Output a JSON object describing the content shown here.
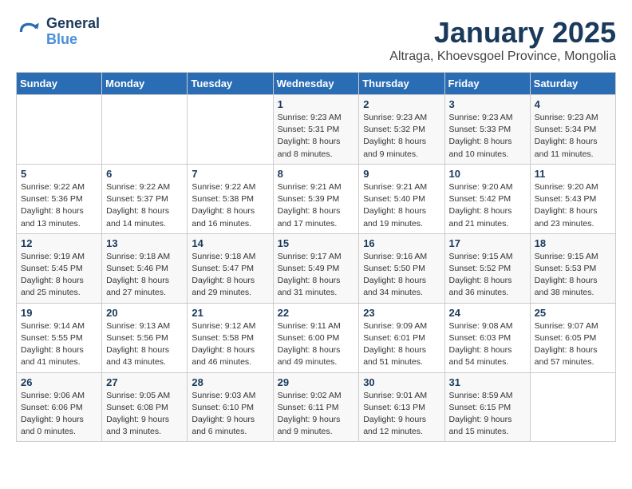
{
  "logo": {
    "line1": "General",
    "line2": "Blue"
  },
  "title": "January 2025",
  "location": "Altraga, Khoevsgoel Province, Mongolia",
  "days_of_week": [
    "Sunday",
    "Monday",
    "Tuesday",
    "Wednesday",
    "Thursday",
    "Friday",
    "Saturday"
  ],
  "weeks": [
    [
      {
        "num": "",
        "info": ""
      },
      {
        "num": "",
        "info": ""
      },
      {
        "num": "",
        "info": ""
      },
      {
        "num": "1",
        "info": "Sunrise: 9:23 AM\nSunset: 5:31 PM\nDaylight: 8 hours\nand 8 minutes."
      },
      {
        "num": "2",
        "info": "Sunrise: 9:23 AM\nSunset: 5:32 PM\nDaylight: 8 hours\nand 9 minutes."
      },
      {
        "num": "3",
        "info": "Sunrise: 9:23 AM\nSunset: 5:33 PM\nDaylight: 8 hours\nand 10 minutes."
      },
      {
        "num": "4",
        "info": "Sunrise: 9:23 AM\nSunset: 5:34 PM\nDaylight: 8 hours\nand 11 minutes."
      }
    ],
    [
      {
        "num": "5",
        "info": "Sunrise: 9:22 AM\nSunset: 5:36 PM\nDaylight: 8 hours\nand 13 minutes."
      },
      {
        "num": "6",
        "info": "Sunrise: 9:22 AM\nSunset: 5:37 PM\nDaylight: 8 hours\nand 14 minutes."
      },
      {
        "num": "7",
        "info": "Sunrise: 9:22 AM\nSunset: 5:38 PM\nDaylight: 8 hours\nand 16 minutes."
      },
      {
        "num": "8",
        "info": "Sunrise: 9:21 AM\nSunset: 5:39 PM\nDaylight: 8 hours\nand 17 minutes."
      },
      {
        "num": "9",
        "info": "Sunrise: 9:21 AM\nSunset: 5:40 PM\nDaylight: 8 hours\nand 19 minutes."
      },
      {
        "num": "10",
        "info": "Sunrise: 9:20 AM\nSunset: 5:42 PM\nDaylight: 8 hours\nand 21 minutes."
      },
      {
        "num": "11",
        "info": "Sunrise: 9:20 AM\nSunset: 5:43 PM\nDaylight: 8 hours\nand 23 minutes."
      }
    ],
    [
      {
        "num": "12",
        "info": "Sunrise: 9:19 AM\nSunset: 5:45 PM\nDaylight: 8 hours\nand 25 minutes."
      },
      {
        "num": "13",
        "info": "Sunrise: 9:18 AM\nSunset: 5:46 PM\nDaylight: 8 hours\nand 27 minutes."
      },
      {
        "num": "14",
        "info": "Sunrise: 9:18 AM\nSunset: 5:47 PM\nDaylight: 8 hours\nand 29 minutes."
      },
      {
        "num": "15",
        "info": "Sunrise: 9:17 AM\nSunset: 5:49 PM\nDaylight: 8 hours\nand 31 minutes."
      },
      {
        "num": "16",
        "info": "Sunrise: 9:16 AM\nSunset: 5:50 PM\nDaylight: 8 hours\nand 34 minutes."
      },
      {
        "num": "17",
        "info": "Sunrise: 9:15 AM\nSunset: 5:52 PM\nDaylight: 8 hours\nand 36 minutes."
      },
      {
        "num": "18",
        "info": "Sunrise: 9:15 AM\nSunset: 5:53 PM\nDaylight: 8 hours\nand 38 minutes."
      }
    ],
    [
      {
        "num": "19",
        "info": "Sunrise: 9:14 AM\nSunset: 5:55 PM\nDaylight: 8 hours\nand 41 minutes."
      },
      {
        "num": "20",
        "info": "Sunrise: 9:13 AM\nSunset: 5:56 PM\nDaylight: 8 hours\nand 43 minutes."
      },
      {
        "num": "21",
        "info": "Sunrise: 9:12 AM\nSunset: 5:58 PM\nDaylight: 8 hours\nand 46 minutes."
      },
      {
        "num": "22",
        "info": "Sunrise: 9:11 AM\nSunset: 6:00 PM\nDaylight: 8 hours\nand 49 minutes."
      },
      {
        "num": "23",
        "info": "Sunrise: 9:09 AM\nSunset: 6:01 PM\nDaylight: 8 hours\nand 51 minutes."
      },
      {
        "num": "24",
        "info": "Sunrise: 9:08 AM\nSunset: 6:03 PM\nDaylight: 8 hours\nand 54 minutes."
      },
      {
        "num": "25",
        "info": "Sunrise: 9:07 AM\nSunset: 6:05 PM\nDaylight: 8 hours\nand 57 minutes."
      }
    ],
    [
      {
        "num": "26",
        "info": "Sunrise: 9:06 AM\nSunset: 6:06 PM\nDaylight: 9 hours\nand 0 minutes."
      },
      {
        "num": "27",
        "info": "Sunrise: 9:05 AM\nSunset: 6:08 PM\nDaylight: 9 hours\nand 3 minutes."
      },
      {
        "num": "28",
        "info": "Sunrise: 9:03 AM\nSunset: 6:10 PM\nDaylight: 9 hours\nand 6 minutes."
      },
      {
        "num": "29",
        "info": "Sunrise: 9:02 AM\nSunset: 6:11 PM\nDaylight: 9 hours\nand 9 minutes."
      },
      {
        "num": "30",
        "info": "Sunrise: 9:01 AM\nSunset: 6:13 PM\nDaylight: 9 hours\nand 12 minutes."
      },
      {
        "num": "31",
        "info": "Sunrise: 8:59 AM\nSunset: 6:15 PM\nDaylight: 9 hours\nand 15 minutes."
      },
      {
        "num": "",
        "info": ""
      }
    ]
  ]
}
